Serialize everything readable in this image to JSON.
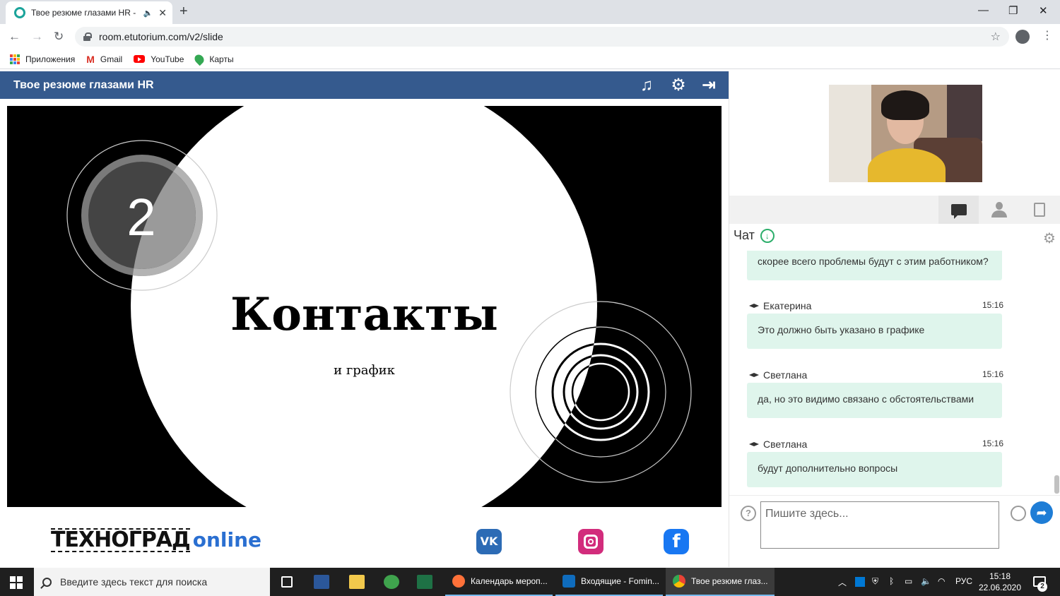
{
  "browser": {
    "tab_title": "Твое резюме глазами HR - Е",
    "url": "room.etutorium.com/v2/slide",
    "bookmarks": [
      "Приложения",
      "Gmail",
      "YouTube",
      "Карты"
    ]
  },
  "app": {
    "title": "Твое резюме глазами HR"
  },
  "slide": {
    "number": "2",
    "title": "Контакты",
    "subtitle": "и график"
  },
  "footer": {
    "brand_main": "ТЕХНОГРАД",
    "brand_suffix": "online",
    "vk_label": "VK",
    "fb_label": "f"
  },
  "chat": {
    "header": "Чат",
    "messages": [
      {
        "author": "",
        "time": "",
        "text": "скорее всего проблемы будут с этим работником?"
      },
      {
        "author": "Екатерина",
        "time": "15:16",
        "text": "Это должно быть указано в графике"
      },
      {
        "author": "Светлана",
        "time": "15:16",
        "text": "да, но это видимо связано с обстоятельствами"
      },
      {
        "author": "Светлана",
        "time": "15:16",
        "text": "будут дополнительно вопросы"
      }
    ],
    "input_placeholder": "Пишите здесь...",
    "help_glyph": "?"
  },
  "taskbar": {
    "search_placeholder": "Введите здесь текст для поиска",
    "apps": [
      "Календарь мероп...",
      "Входящие - Fomin...",
      "Твое резюме глаз..."
    ],
    "lang": "РУС",
    "time": "15:18",
    "date": "22.06.2020",
    "notifications": "2"
  },
  "colors": {
    "app_header": "#355a8e",
    "chat_bubble": "#dff5ec",
    "brand_online": "#2a6fd1"
  }
}
